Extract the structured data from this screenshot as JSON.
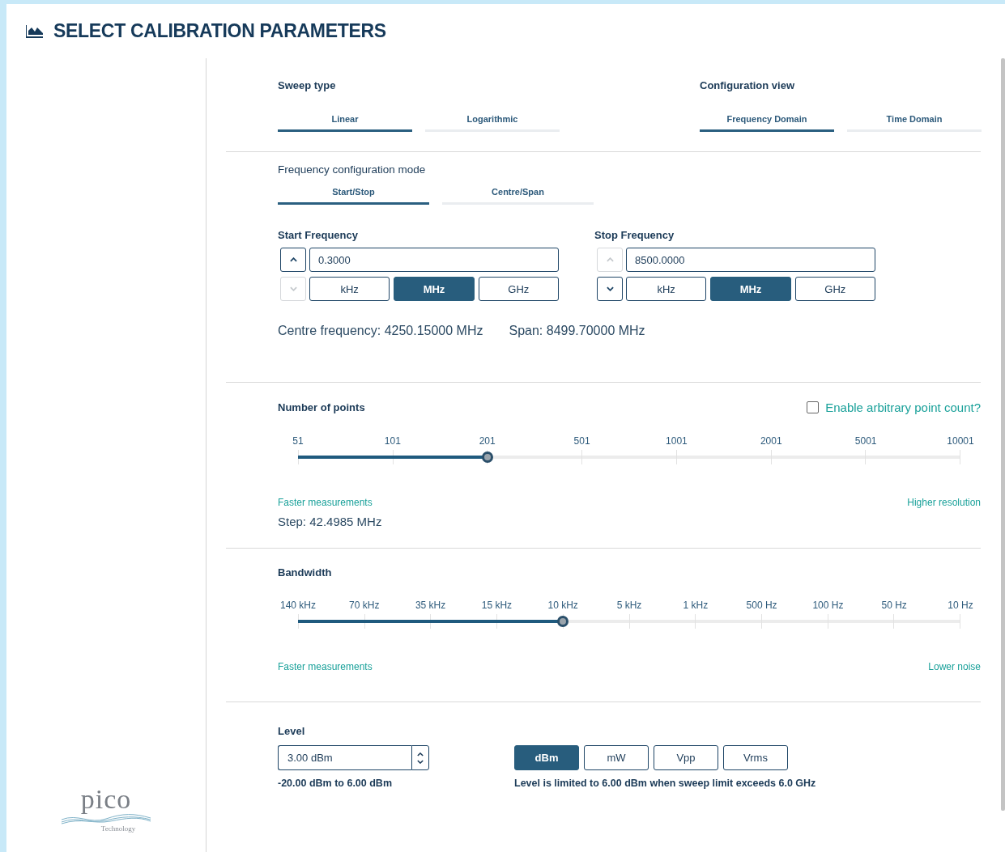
{
  "header": {
    "title": "SELECT CALIBRATION PARAMETERS"
  },
  "logo": {
    "name": "pico",
    "tagline": "Technology"
  },
  "sweep_type": {
    "label": "Sweep type",
    "tabs": [
      {
        "label": "Linear",
        "selected": true
      },
      {
        "label": "Logarithmic",
        "selected": false
      }
    ]
  },
  "configuration_view": {
    "label": "Configuration view",
    "tabs": [
      {
        "label": "Frequency Domain",
        "selected": true
      },
      {
        "label": "Time Domain",
        "selected": false
      }
    ]
  },
  "frequency_mode": {
    "label": "Frequency configuration mode",
    "tabs": [
      {
        "label": "Start/Stop",
        "selected": true
      },
      {
        "label": "Centre/Span",
        "selected": false
      }
    ]
  },
  "frequency_fields": [
    {
      "label": "Start Frequency",
      "value": "0.3000",
      "up_disabled": false,
      "down_disabled": true,
      "units": [
        {
          "label": "kHz",
          "selected": false
        },
        {
          "label": "MHz",
          "selected": true
        },
        {
          "label": "GHz",
          "selected": false
        }
      ]
    },
    {
      "label": "Stop Frequency",
      "value": "8500.0000",
      "up_disabled": true,
      "down_disabled": false,
      "units": [
        {
          "label": "kHz",
          "selected": false
        },
        {
          "label": "MHz",
          "selected": true
        },
        {
          "label": "GHz",
          "selected": false
        }
      ]
    }
  ],
  "centre_frequency": "Centre frequency: 4250.15000 MHz",
  "span": "Span: 8499.70000 MHz",
  "points": {
    "label": "Number of points",
    "checkbox": {
      "label": "Enable arbitrary point count?",
      "checked": false
    },
    "ticks": [
      "51",
      "101",
      "201",
      "501",
      "1001",
      "2001",
      "5001",
      "10001"
    ],
    "level": 0.2857,
    "left_hint": "Faster measurements",
    "right_hint": "Higher resolution",
    "step": "Step: 42.4985 MHz"
  },
  "bandwidth": {
    "label": "Bandwidth",
    "ticks": [
      "140 kHz",
      "70 kHz",
      "35 kHz",
      "15 kHz",
      "10 kHz",
      "5 kHz",
      "1 kHz",
      "500 Hz",
      "100 Hz",
      "50 Hz",
      "10 Hz"
    ],
    "level": 0.4,
    "left_hint": "Faster measurements",
    "right_hint": "Lower noise"
  },
  "level": {
    "label": "Level",
    "value": "3.00 dBm",
    "range": "-20.00 dBm to 6.00 dBm",
    "units": [
      {
        "label": "dBm",
        "selected": true
      },
      {
        "label": "mW",
        "selected": false
      },
      {
        "label": "Vpp",
        "selected": false
      },
      {
        "label": "Vrms",
        "selected": false
      }
    ],
    "note": "Level is limited to 6.00 dBm when sweep limit exceeds 6.0 GHz"
  }
}
